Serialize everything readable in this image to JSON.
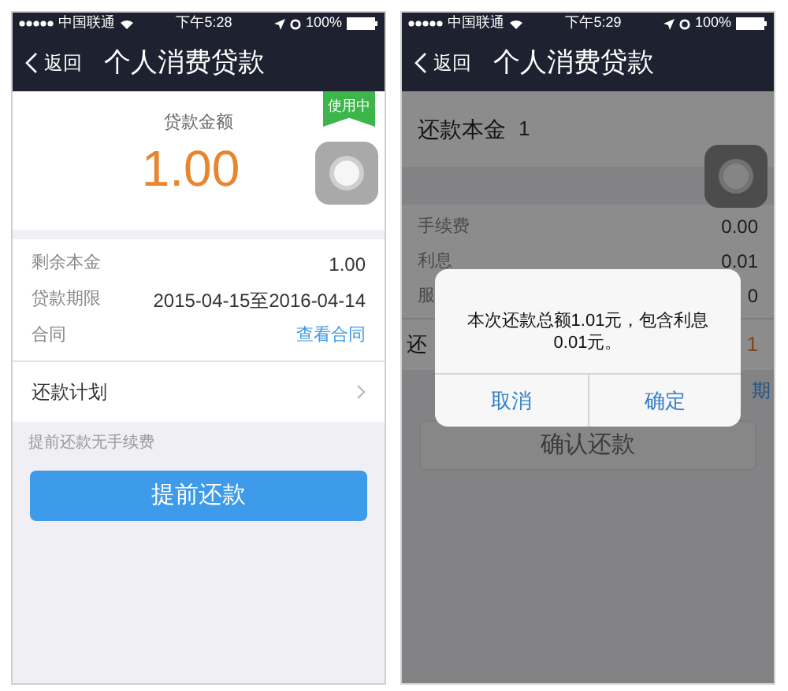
{
  "left_screen": {
    "status_bar": {
      "carrier": "中国联通",
      "time": "下午5:28",
      "battery": "100%"
    },
    "nav": {
      "back": "返回",
      "title": "个人消费贷款"
    },
    "loan_card": {
      "label": "贷款金额",
      "amount": "1.00",
      "badge": "使用中"
    },
    "details": [
      {
        "label": "剩余本金",
        "value": "1.00",
        "kind": "text"
      },
      {
        "label": "贷款期限",
        "value": "2015-04-15至2016-04-14",
        "kind": "text"
      },
      {
        "label": "合同",
        "value": "查看合同",
        "kind": "link"
      }
    ],
    "plan_row": {
      "label": "还款计划"
    },
    "note": "提前还款无手续费",
    "button": {
      "label": "提前还款",
      "disabled": false
    }
  },
  "right_screen": {
    "status_bar": {
      "carrier": "中国联通",
      "time": "下午5:29",
      "battery": "100%"
    },
    "nav": {
      "back": "返回",
      "title": "个人消费贷款"
    },
    "principal": {
      "label": "还款本金",
      "value": "1"
    },
    "rows": [
      {
        "label": "手续费",
        "value": "0.00"
      },
      {
        "label": "利息",
        "value": "0.01"
      },
      {
        "label": "服",
        "value": "0"
      }
    ],
    "total_row": {
      "label": "还",
      "value": "1"
    },
    "link_fragment": "期",
    "button": {
      "label": "确认还款",
      "disabled": true
    },
    "dialog": {
      "message": "本次还款总额1.01元，包含利息0.01元。",
      "buttons": [
        {
          "label": "取消"
        },
        {
          "label": "确定"
        }
      ]
    }
  }
}
